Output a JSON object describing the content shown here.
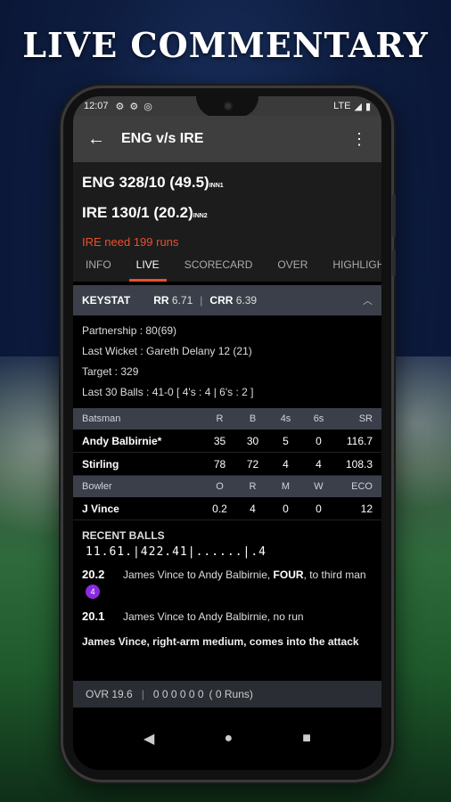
{
  "headline": "LIVE COMMENTARY",
  "statusbar": {
    "time": "12:07",
    "network": "LTE"
  },
  "appbar": {
    "title": "ENG  v/s  IRE"
  },
  "scores": {
    "line1": "ENG 328/10 (49.5)",
    "line1_inn": "INN1",
    "line2": "IRE 130/1 (20.2)",
    "line2_inn": "INN2",
    "need": "IRE need 199 runs"
  },
  "tabs": [
    "INFO",
    "LIVE",
    "SCORECARD",
    "OVER",
    "HIGHLIGHTS"
  ],
  "keystat": {
    "label": "KEYSTAT",
    "rr_label": "RR",
    "rr": "6.71",
    "crr_label": "CRR",
    "crr": "6.39"
  },
  "info": {
    "partnership": "Partnership : 80(69)",
    "last_wicket": "Last Wicket : Gareth Delany 12 (21)",
    "target": "Target : 329",
    "last30": "Last 30 Balls : 41-0 [ 4's : 4 | 6's : 2 ]"
  },
  "batsman_table": {
    "headers": [
      "Batsman",
      "R",
      "B",
      "4s",
      "6s",
      "SR"
    ],
    "rows": [
      [
        "Andy Balbirnie*",
        "35",
        "30",
        "5",
        "0",
        "116.7"
      ],
      [
        "Stirling",
        "78",
        "72",
        "4",
        "4",
        "108.3"
      ]
    ]
  },
  "bowler_table": {
    "headers": [
      "Bowler",
      "O",
      "R",
      "M",
      "W",
      "ECO"
    ],
    "rows": [
      [
        "J Vince",
        "0.2",
        "4",
        "0",
        "0",
        "12"
      ]
    ]
  },
  "recent": {
    "title": "RECENT BALLS",
    "balls": "11.61.|422.41|......|.4"
  },
  "commentary": [
    {
      "over": "20.2",
      "text_pre": "James Vince to Andy Balbirnie, ",
      "text_bold": "FOUR",
      "text_post": ", to third man",
      "badge": "4"
    },
    {
      "over": "20.1",
      "text_pre": "James Vince to Andy Balbirnie, no run",
      "text_bold": "",
      "text_post": "",
      "badge": ""
    }
  ],
  "attack_note": "James Vince, right-arm medium, comes into the attack",
  "ovr_bar": {
    "label": "OVR 19.6",
    "balls": "0 0 0 0 0 0",
    "runs": "( 0 Runs)"
  }
}
